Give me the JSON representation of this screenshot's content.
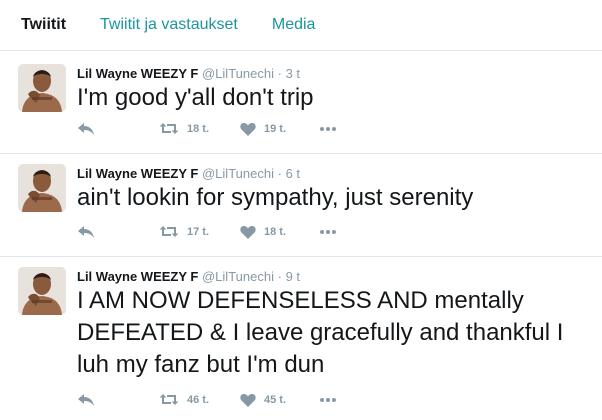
{
  "tabs": [
    {
      "label": "Twiitit"
    },
    {
      "label": "Twiitit ja vastaukset"
    },
    {
      "label": "Media"
    }
  ],
  "tweets": [
    {
      "author": "Lil Wayne WEEZY F",
      "handle": "@LilTunechi",
      "separator": "·",
      "time": "3 t",
      "text": "I'm good y'all don't trip",
      "retweets": "18 t.",
      "likes": "19 t."
    },
    {
      "author": "Lil Wayne WEEZY F",
      "handle": "@LilTunechi",
      "separator": "·",
      "time": "6 t",
      "text": "ain't lookin for sympathy, just serenity",
      "retweets": "17 t.",
      "likes": "18 t."
    },
    {
      "author": "Lil Wayne WEEZY F",
      "handle": "@LilTunechi",
      "separator": "·",
      "time": "9 t",
      "text": "I AM NOW DEFENSELESS AND mentally DEFEATED & I leave gracefully and thankful I luh my fanz but I'm dun",
      "retweets": "46 t.",
      "likes": "45 t."
    }
  ],
  "icons": {
    "reply": "reply-icon",
    "retweet": "retweet-icon",
    "like": "heart-icon",
    "more": "more-dots-icon"
  },
  "colors": {
    "tab_link": "#1b95a0",
    "muted": "#8899a6",
    "background": "#f5f8fa",
    "divider": "#e1e8ed"
  }
}
